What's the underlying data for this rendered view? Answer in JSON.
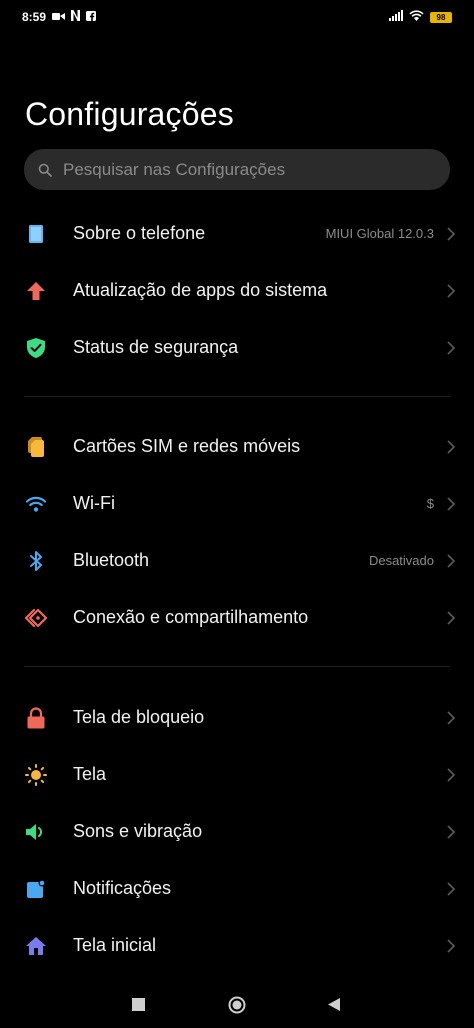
{
  "status_bar": {
    "time": "8:59",
    "left_icons": [
      "video-camera-icon",
      "netflix-icon",
      "facebook-icon"
    ],
    "right_icons": [
      "signal-icon",
      "wifi-icon"
    ],
    "battery_level": "98"
  },
  "page": {
    "title": "Configurações"
  },
  "search": {
    "placeholder": "Pesquisar nas Configurações"
  },
  "colors": {
    "background": "#000000",
    "search_bg": "#2b2b2b",
    "secondary_text": "#8c8c8c"
  },
  "settings": {
    "group1": [
      {
        "label": "Sobre o telefone",
        "value": "MIUI Global 12.0.3",
        "icon": "phone-icon",
        "icon_color": "#5fb8f5"
      },
      {
        "label": "Atualização de apps do sistema",
        "value": "",
        "icon": "arrow-up-icon",
        "icon_color": "#f0685a"
      },
      {
        "label": "Status de segurança",
        "value": "",
        "icon": "shield-check-icon",
        "icon_color": "#3ddc84"
      }
    ],
    "group2": [
      {
        "label": "Cartões SIM e redes móveis",
        "value": "",
        "icon": "sim-card-icon",
        "icon_color": "#f6b93b"
      },
      {
        "label": "Wi-Fi",
        "value": "$",
        "icon": "wifi-icon",
        "icon_color": "#4aa8f0"
      },
      {
        "label": "Bluetooth",
        "value": "Desativado",
        "icon": "bluetooth-icon",
        "icon_color": "#4aa8f0"
      },
      {
        "label": "Conexão e compartilhamento",
        "value": "",
        "icon": "share-connection-icon",
        "icon_color": "#f0685a"
      }
    ],
    "group3": [
      {
        "label": "Tela de bloqueio",
        "value": "",
        "icon": "lock-icon",
        "icon_color": "#f0685a"
      },
      {
        "label": "Tela",
        "value": "",
        "icon": "sun-icon",
        "icon_color": "#f6b93b"
      },
      {
        "label": "Sons e vibração",
        "value": "",
        "icon": "speaker-icon",
        "icon_color": "#3ddc84"
      },
      {
        "label": "Notificações",
        "value": "",
        "icon": "notification-icon",
        "icon_color": "#4aa8f0"
      },
      {
        "label": "Tela inicial",
        "value": "",
        "icon": "home-icon",
        "icon_color": "#7b7bf0"
      }
    ]
  },
  "nav_bar": {
    "buttons": [
      "recents-square-icon",
      "home-circle-icon",
      "back-triangle-icon"
    ]
  }
}
